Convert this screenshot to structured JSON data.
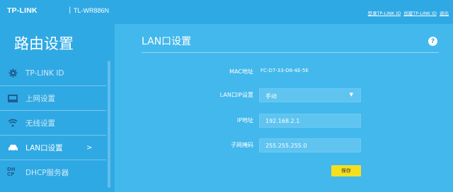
{
  "header": {
    "brand": "TP-LINK",
    "model": "TL-WR886N",
    "links": [
      "登录TP-LINK ID",
      "创建TP-LINK ID",
      "退出"
    ]
  },
  "sidebar": {
    "title": "路由设置",
    "items": [
      {
        "label": "TP-LINK ID",
        "icon": "gear-icon",
        "active": false
      },
      {
        "label": "上网设置",
        "icon": "monitor-icon",
        "active": false
      },
      {
        "label": "无线设置",
        "icon": "wifi-icon",
        "active": false
      },
      {
        "label": "LAN口设置",
        "icon": "car-icon",
        "active": true,
        "arrow": ">"
      },
      {
        "label": "DHCP服务器",
        "icon": "dhcp-icon",
        "active": false
      }
    ]
  },
  "panel": {
    "title": "LAN口设置",
    "help": "?",
    "mac": {
      "label": "MAC地址",
      "value": "FC-D7-33-D8-4E-5E"
    },
    "ip_mode": {
      "label": "LAN口IP设置",
      "value": "手动"
    },
    "ip": {
      "label": "IP地址",
      "value": "192.168.2.1"
    },
    "mask": {
      "label": "子网掩码",
      "value": "255.255.255.0"
    },
    "save_label": "保存"
  },
  "colors": {
    "background": "#2fa9e4",
    "panel": "#43b8ec",
    "save_button": "#f4e020"
  }
}
